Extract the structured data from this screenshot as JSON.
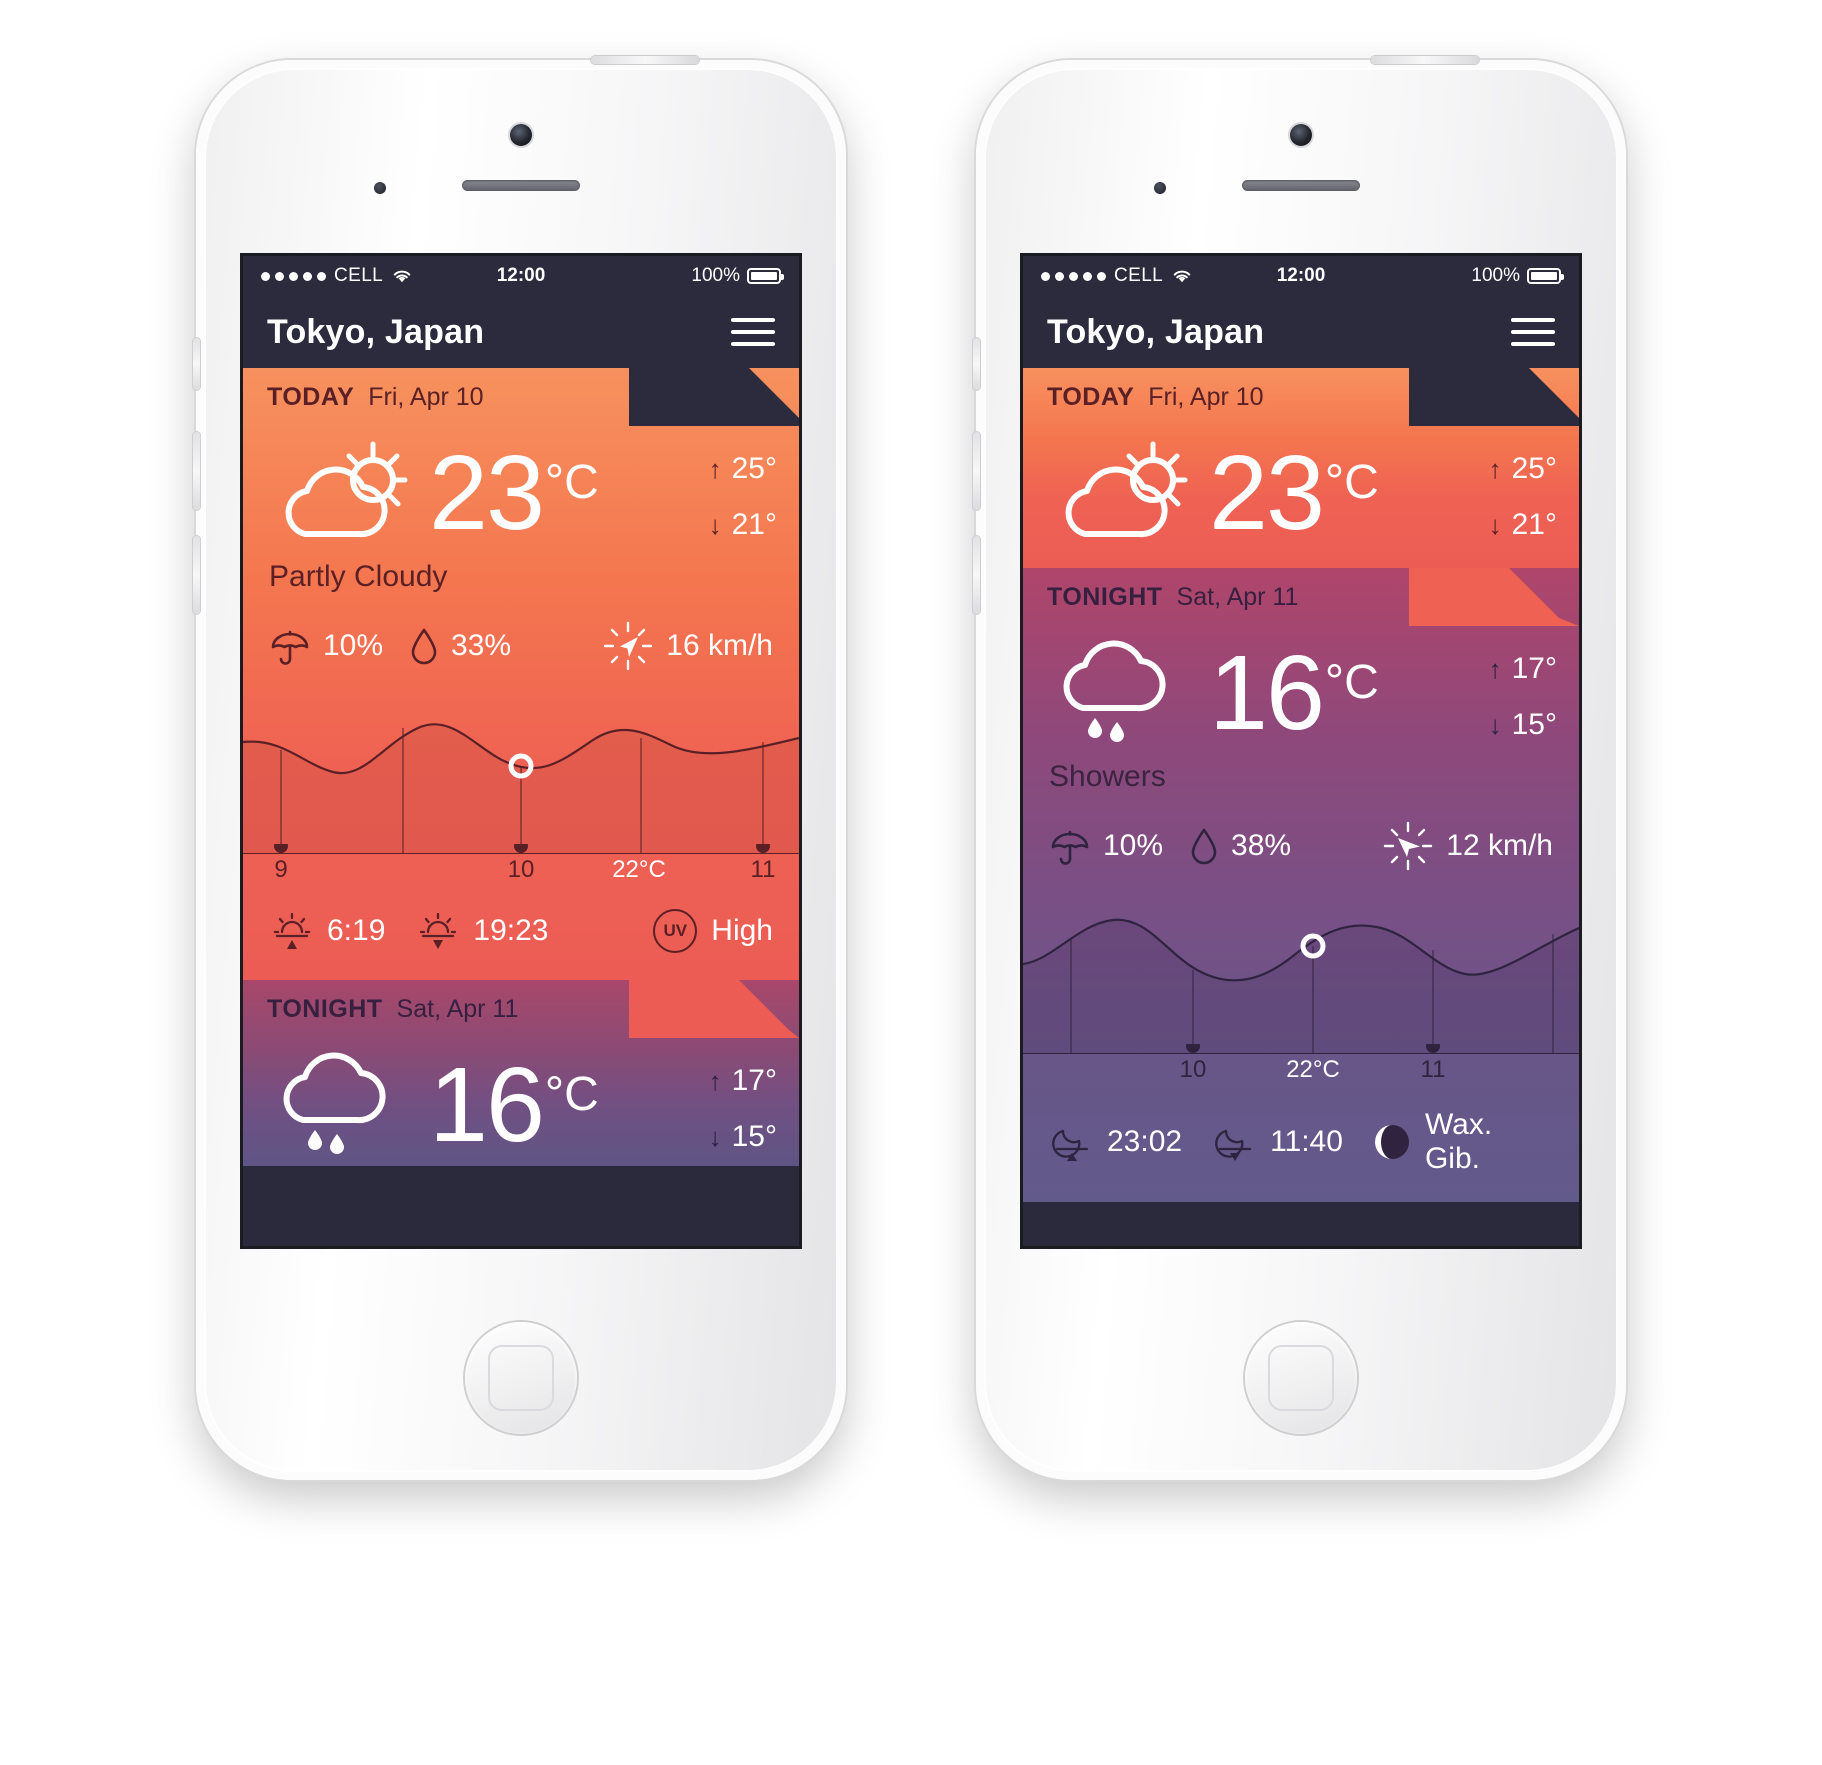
{
  "app": {
    "city": "Tokyo, Japan",
    "menu_icon": "hamburger-icon"
  },
  "status_bar": {
    "carrier": "CELL",
    "time": "12:00",
    "battery_pct": "100%",
    "signal_dots": 5
  },
  "colors": {
    "day_top": "#f7915e",
    "day_bottom": "#ec5c54",
    "night_top": "#b0456a",
    "night_bottom": "#635a8c",
    "navbar": "#2b2b3d",
    "dark_text": "#5a2026",
    "night_text": "#37203f"
  },
  "today": {
    "label": "TODAY",
    "date": "Fri, Apr 10",
    "icon": "sun-behind-cloud-icon",
    "temp": "23",
    "unit": "°C",
    "high_arrow": "↑",
    "high": "25°",
    "low_arrow": "↓",
    "low": "21°",
    "condition": "Partly Cloudy",
    "precip_icon": "umbrella-icon",
    "precip": "10%",
    "humidity_icon": "water-drop-icon",
    "humidity": "33%",
    "wind_icon": "wind-compass-icon",
    "wind": "16 km/h",
    "sunrise_icon": "sunrise-icon",
    "sunrise": "6:19",
    "sunset_icon": "sunset-icon",
    "sunset": "19:23",
    "uv_badge": "UV",
    "uv_level": "High"
  },
  "tonight": {
    "label": "TONIGHT",
    "date": "Sat, Apr 11",
    "icon": "rain-cloud-icon",
    "temp": "16",
    "unit": "°C",
    "high_arrow": "↑",
    "high": "17°",
    "low_arrow": "↓",
    "low": "15°",
    "condition": "Showers",
    "precip_icon": "umbrella-icon",
    "precip": "10%",
    "humidity_icon": "water-drop-icon",
    "humidity": "38%",
    "wind_icon": "wind-compass-icon",
    "wind": "12 km/h",
    "moonrise_icon": "moonrise-icon",
    "moonrise": "23:02",
    "moonset_icon": "moonset-icon",
    "moonset": "11:40",
    "moon_phase_icon": "waxing-gibbous-icon",
    "moon_phase": "Wax. Gib."
  },
  "chart_data": [
    {
      "type": "area",
      "id": "today-temp-curve",
      "title": "",
      "xlabel": "",
      "ylabel": "",
      "categories": [
        "9",
        "10",
        "22°C",
        "11"
      ],
      "tick_labels": [
        {
          "label": "9",
          "highlight": false
        },
        {
          "label": "10",
          "highlight": false
        },
        {
          "label": "22°C",
          "highlight": true
        },
        {
          "label": "11",
          "highlight": false
        }
      ],
      "values": [
        22,
        21,
        20,
        21,
        23,
        24,
        23,
        21,
        20,
        21,
        22,
        23,
        22
      ],
      "marker": {
        "x_index": 8,
        "label": "22°C"
      },
      "grid": true,
      "legend": "none"
    },
    {
      "type": "area",
      "id": "tonight-temp-curve",
      "title": "",
      "xlabel": "",
      "ylabel": "",
      "categories": [
        "10",
        "22°C",
        "11"
      ],
      "tick_labels": [
        {
          "label": "10",
          "highlight": false
        },
        {
          "label": "22°C",
          "highlight": true
        },
        {
          "label": "11",
          "highlight": false
        }
      ],
      "values": [
        16,
        17,
        18,
        17,
        16,
        15,
        16,
        17,
        18,
        17,
        16,
        17,
        18
      ],
      "marker": {
        "x_index": 6,
        "label": "22°C"
      },
      "grid": true,
      "legend": "none"
    }
  ]
}
